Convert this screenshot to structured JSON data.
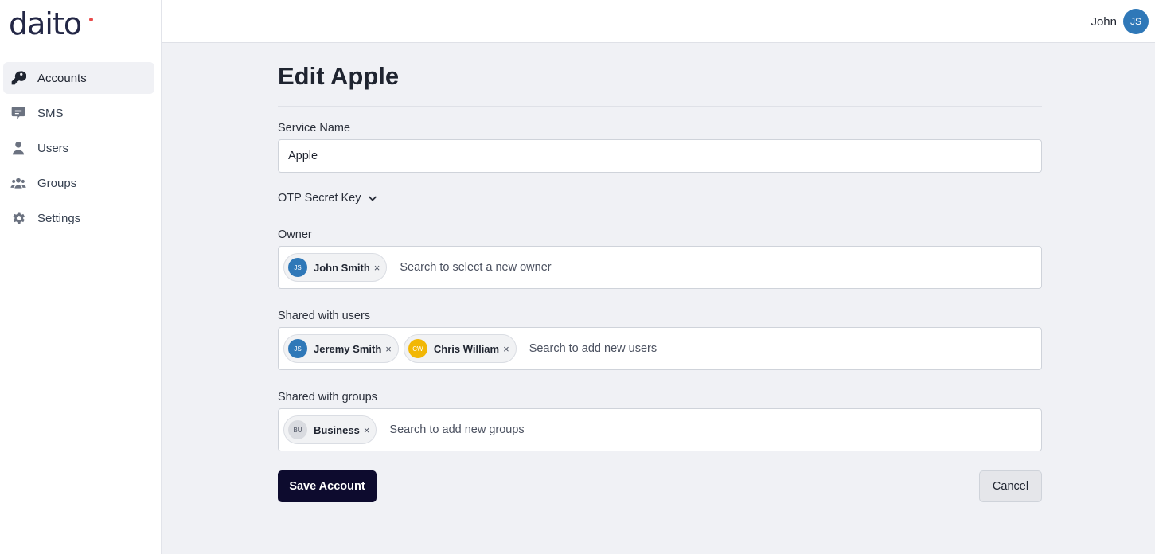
{
  "brand": {
    "logo_text": "daito"
  },
  "sidebar": {
    "items": [
      {
        "label": "Accounts",
        "icon": "key-icon",
        "active": true
      },
      {
        "label": "SMS",
        "icon": "chat-icon",
        "active": false
      },
      {
        "label": "Users",
        "icon": "user-icon",
        "active": false
      },
      {
        "label": "Groups",
        "icon": "users-group-icon",
        "active": false
      },
      {
        "label": "Settings",
        "icon": "gear-icon",
        "active": false
      }
    ]
  },
  "header": {
    "user_name": "John",
    "user_initials": "JS",
    "avatar_color": "#2f78b8"
  },
  "form": {
    "title": "Edit Apple",
    "service_name": {
      "label": "Service Name",
      "value": "Apple"
    },
    "otp": {
      "label": "OTP Secret Key"
    },
    "owner": {
      "label": "Owner",
      "chips": [
        {
          "initials": "JS",
          "name": "John Smith",
          "color": "#2f78b8"
        }
      ],
      "placeholder": "Search to select a new owner"
    },
    "shared_users": {
      "label": "Shared with users",
      "chips": [
        {
          "initials": "JS",
          "name": "Jeremy Smith",
          "color": "#2f78b8"
        },
        {
          "initials": "CW",
          "name": "Chris William",
          "color": "#f2b705"
        }
      ],
      "placeholder": "Search to add new users"
    },
    "shared_groups": {
      "label": "Shared with groups",
      "chips": [
        {
          "initials": "BU",
          "name": "Business",
          "color": "#d9dbe0"
        }
      ],
      "placeholder": "Search to add new groups"
    },
    "save_label": "Save Account",
    "cancel_label": "Cancel"
  },
  "colors": {
    "primary_button": "#0d0b2e",
    "background": "#f0f1f5",
    "logo_accent": "#e94b4b"
  }
}
